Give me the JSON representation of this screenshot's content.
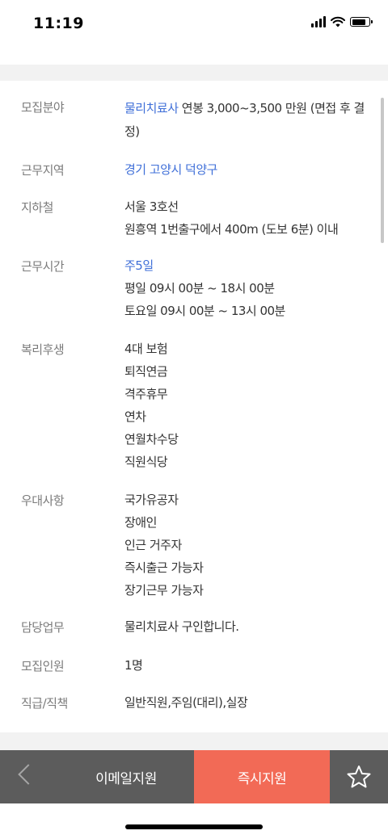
{
  "status": {
    "time": "11:19"
  },
  "fields": {
    "recruit_field": {
      "label": "모집분야",
      "highlight": "물리치료사",
      "text": " 연봉 3,000~3,500 만원 (면접 후 결정)"
    },
    "work_area": {
      "label": "근무지역",
      "value": "경기 고양시 덕양구"
    },
    "subway": {
      "label": "지하철",
      "lines": [
        "서울 3호선",
        "원흥역 1번출구에서 400m (도보 6분) 이내"
      ]
    },
    "work_hours": {
      "label": "근무시간",
      "highlight": "주5일",
      "lines": [
        "평일 09시 00분 ~ 18시 00분",
        "토요일 09시 00분 ~ 13시 00분"
      ]
    },
    "benefits": {
      "label": "복리후생",
      "lines": [
        "4대 보험",
        "퇴직연금",
        "격주휴무",
        "연차",
        "연월차수당",
        "직원식당"
      ]
    },
    "preferences": {
      "label": "우대사항",
      "lines": [
        "국가유공자",
        "장애인",
        "인근 거주자",
        "즉시출근 가능자",
        "장기근무 가능자"
      ]
    },
    "duty": {
      "label": "담당업무",
      "value": "물리치료사 구인합니다."
    },
    "headcount": {
      "label": "모집인원",
      "value": "1명"
    },
    "position": {
      "label": "직급/직책",
      "value": "일반직원,주임(대리),실장"
    }
  },
  "bottom_bar": {
    "back_icon": "chevron-left-icon",
    "email_apply": "이메일지원",
    "instant_apply": "즉시지원",
    "favorite_icon": "star-outline-icon"
  },
  "colors": {
    "link_blue": "#3f6fd8",
    "apply_red": "#f26a56",
    "bar_gray": "#5c5c5c"
  },
  "battery_level": 0.85
}
